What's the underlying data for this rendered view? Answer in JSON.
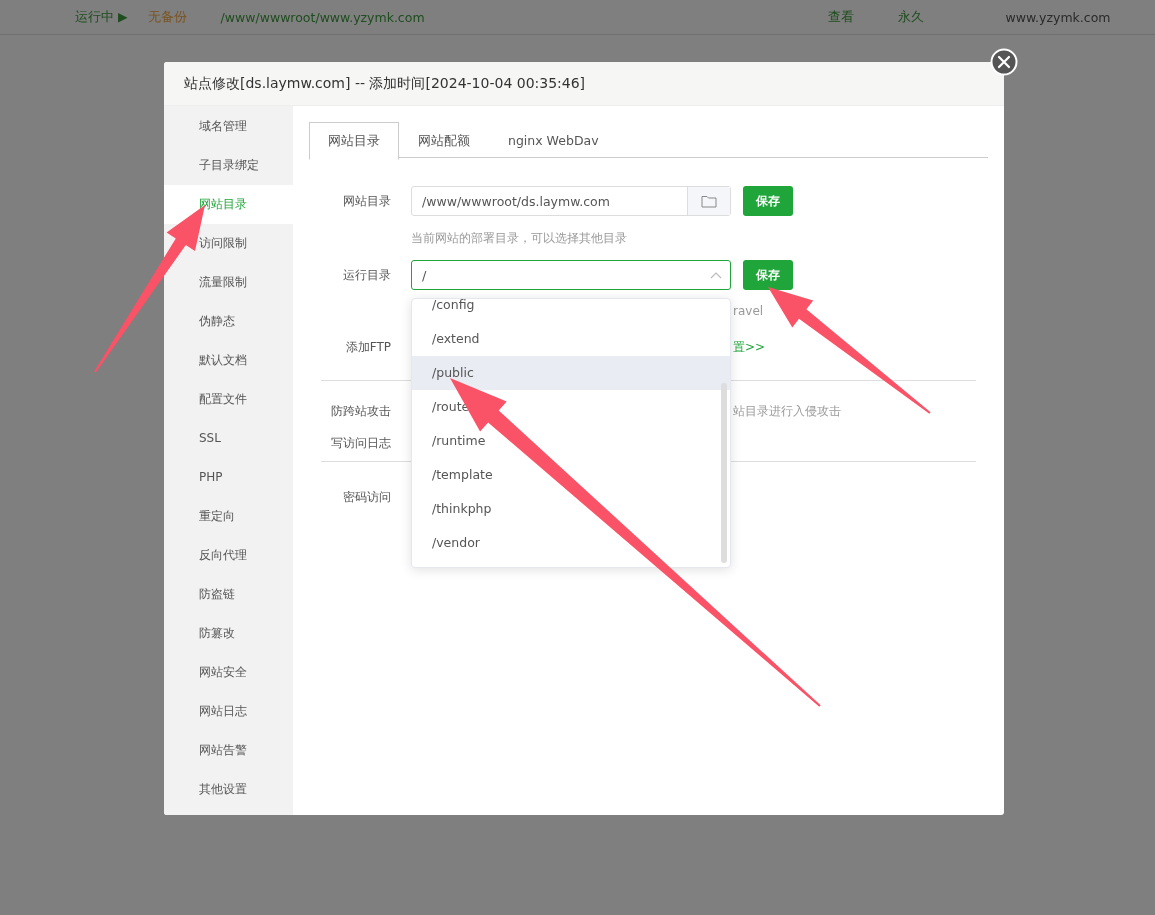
{
  "background_row": {
    "status": "运行中 ▶",
    "backup": "无备份",
    "path": "/www/wwwroot/www.yzymk.com",
    "view": "查看",
    "expiry": "永久",
    "domain": "www.yzymk.com"
  },
  "dialog": {
    "title": "站点修改[ds.laymw.com] -- 添加时间[2024-10-04 00:35:46]"
  },
  "sidebar": {
    "items": [
      {
        "label": "域名管理",
        "selected": false
      },
      {
        "label": "子目录绑定",
        "selected": false
      },
      {
        "label": "网站目录",
        "selected": true
      },
      {
        "label": "访问限制",
        "selected": false
      },
      {
        "label": "流量限制",
        "selected": false
      },
      {
        "label": "伪静态",
        "selected": false
      },
      {
        "label": "默认文档",
        "selected": false
      },
      {
        "label": "配置文件",
        "selected": false
      },
      {
        "label": "SSL",
        "selected": false
      },
      {
        "label": "PHP",
        "selected": false
      },
      {
        "label": "重定向",
        "selected": false
      },
      {
        "label": "反向代理",
        "selected": false
      },
      {
        "label": "防盗链",
        "selected": false
      },
      {
        "label": "防篡改",
        "selected": false
      },
      {
        "label": "网站安全",
        "selected": false
      },
      {
        "label": "网站日志",
        "selected": false
      },
      {
        "label": "网站告警",
        "selected": false
      },
      {
        "label": "其他设置",
        "selected": false
      }
    ]
  },
  "tabs": [
    {
      "label": "网站目录",
      "selected": true
    },
    {
      "label": "网站配额",
      "selected": false
    },
    {
      "label": "nginx WebDav",
      "selected": false
    }
  ],
  "site_dir": {
    "label": "网站目录",
    "value": "/www/wwwroot/ds.laymw.com",
    "button": "保存",
    "hint": "当前网站的部署目录，可以选择其他目录"
  },
  "run_dir": {
    "label": "运行目录",
    "value": "/",
    "button": "保存",
    "hint_fragment": "ravel"
  },
  "ftp": {
    "label": "添加FTP",
    "link_fragment": "置>>"
  },
  "cross_site": {
    "label": "防跨站攻击",
    "hint_fragment": "站目录进行入侵攻击"
  },
  "access_log": {
    "label": "写访问日志"
  },
  "password": {
    "label": "密码访问"
  },
  "dropdown": {
    "options": [
      {
        "label": "/config",
        "selected": false
      },
      {
        "label": "/extend",
        "selected": false
      },
      {
        "label": "/public",
        "selected": true
      },
      {
        "label": "/route",
        "selected": false
      },
      {
        "label": "/runtime",
        "selected": false
      },
      {
        "label": "/template",
        "selected": false
      },
      {
        "label": "/thinkphp",
        "selected": false
      },
      {
        "label": "/vendor",
        "selected": false
      }
    ]
  }
}
